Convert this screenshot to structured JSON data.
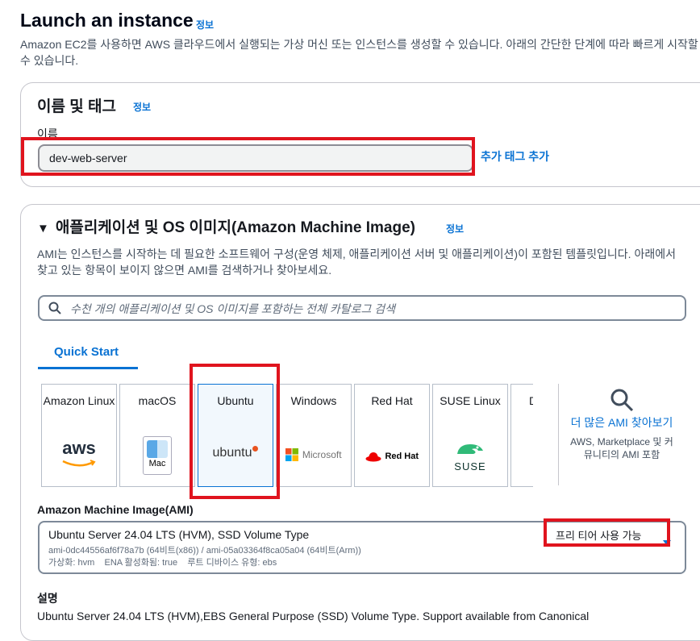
{
  "page": {
    "title": "Launch an instance",
    "info": "정보",
    "description": "Amazon EC2를 사용하면 AWS 클라우드에서 실행되는 가상 머신 또는 인스턴스를 생성할 수 있습니다. 아래의 간단한 단계에 따라 빠르게 시작할 수 있습니다."
  },
  "name_section": {
    "heading": "이름 및 태그",
    "info": "정보",
    "label": "이름",
    "value": "dev-web-server",
    "add_tag": "추가 태그 추가"
  },
  "ami_section": {
    "heading": "애플리케이션 및 OS 이미지(Amazon Machine Image)",
    "info": "정보",
    "description": "AMI는 인스턴스를 시작하는 데 필요한 소프트웨어 구성(운영 체제, 애플리케이션 서버 및 애플리케이션)이 포함된 템플릿입니다. 아래에서 찾고 있는 항목이 보이지 않으면 AMI를 검색하거나 찾아보세요.",
    "search_placeholder": "수천 개의 애플리케이션 및 OS 이미지를 포함하는 전체 카탈로그 검색",
    "tab": "Quick Start",
    "cards": [
      {
        "label": "Amazon Linux",
        "logo": "aws"
      },
      {
        "label": "macOS",
        "logo": "Mac"
      },
      {
        "label": "Ubuntu",
        "logo": "ubuntu",
        "selected": true
      },
      {
        "label": "Windows",
        "logo": "Microsoft"
      },
      {
        "label": "Red Hat",
        "logo": "Red Hat"
      },
      {
        "label": "SUSE Linux",
        "logo": "SUSE"
      },
      {
        "label": "D",
        "logo": ""
      }
    ],
    "more": {
      "link": "더 많은 AMI 찾아보기",
      "sub": "AWS, Marketplace 및 커뮤니티의 AMI 포함"
    },
    "ami_label": "Amazon Machine Image(AMI)",
    "selected_ami": {
      "title": "Ubuntu Server 24.04 LTS (HVM), SSD Volume Type",
      "ids": "ami-0dc44556af6f78a7b (64비트(x86)) / ami-05a03364f8ca05a04 (64비트(Arm))",
      "attrs": "가상화: hvm    ENA 활성화됨: true    루트 디바이스 유형: ebs",
      "badge": "프리 티어 사용 가능"
    },
    "desc_label": "설명",
    "desc_text": "Ubuntu Server 24.04 LTS (HVM),EBS General Purpose (SSD) Volume Type. Support available from Canonical"
  },
  "colors": {
    "link": "#0972d3",
    "highlight": "#e0141e",
    "border": "#c6c6cd"
  }
}
